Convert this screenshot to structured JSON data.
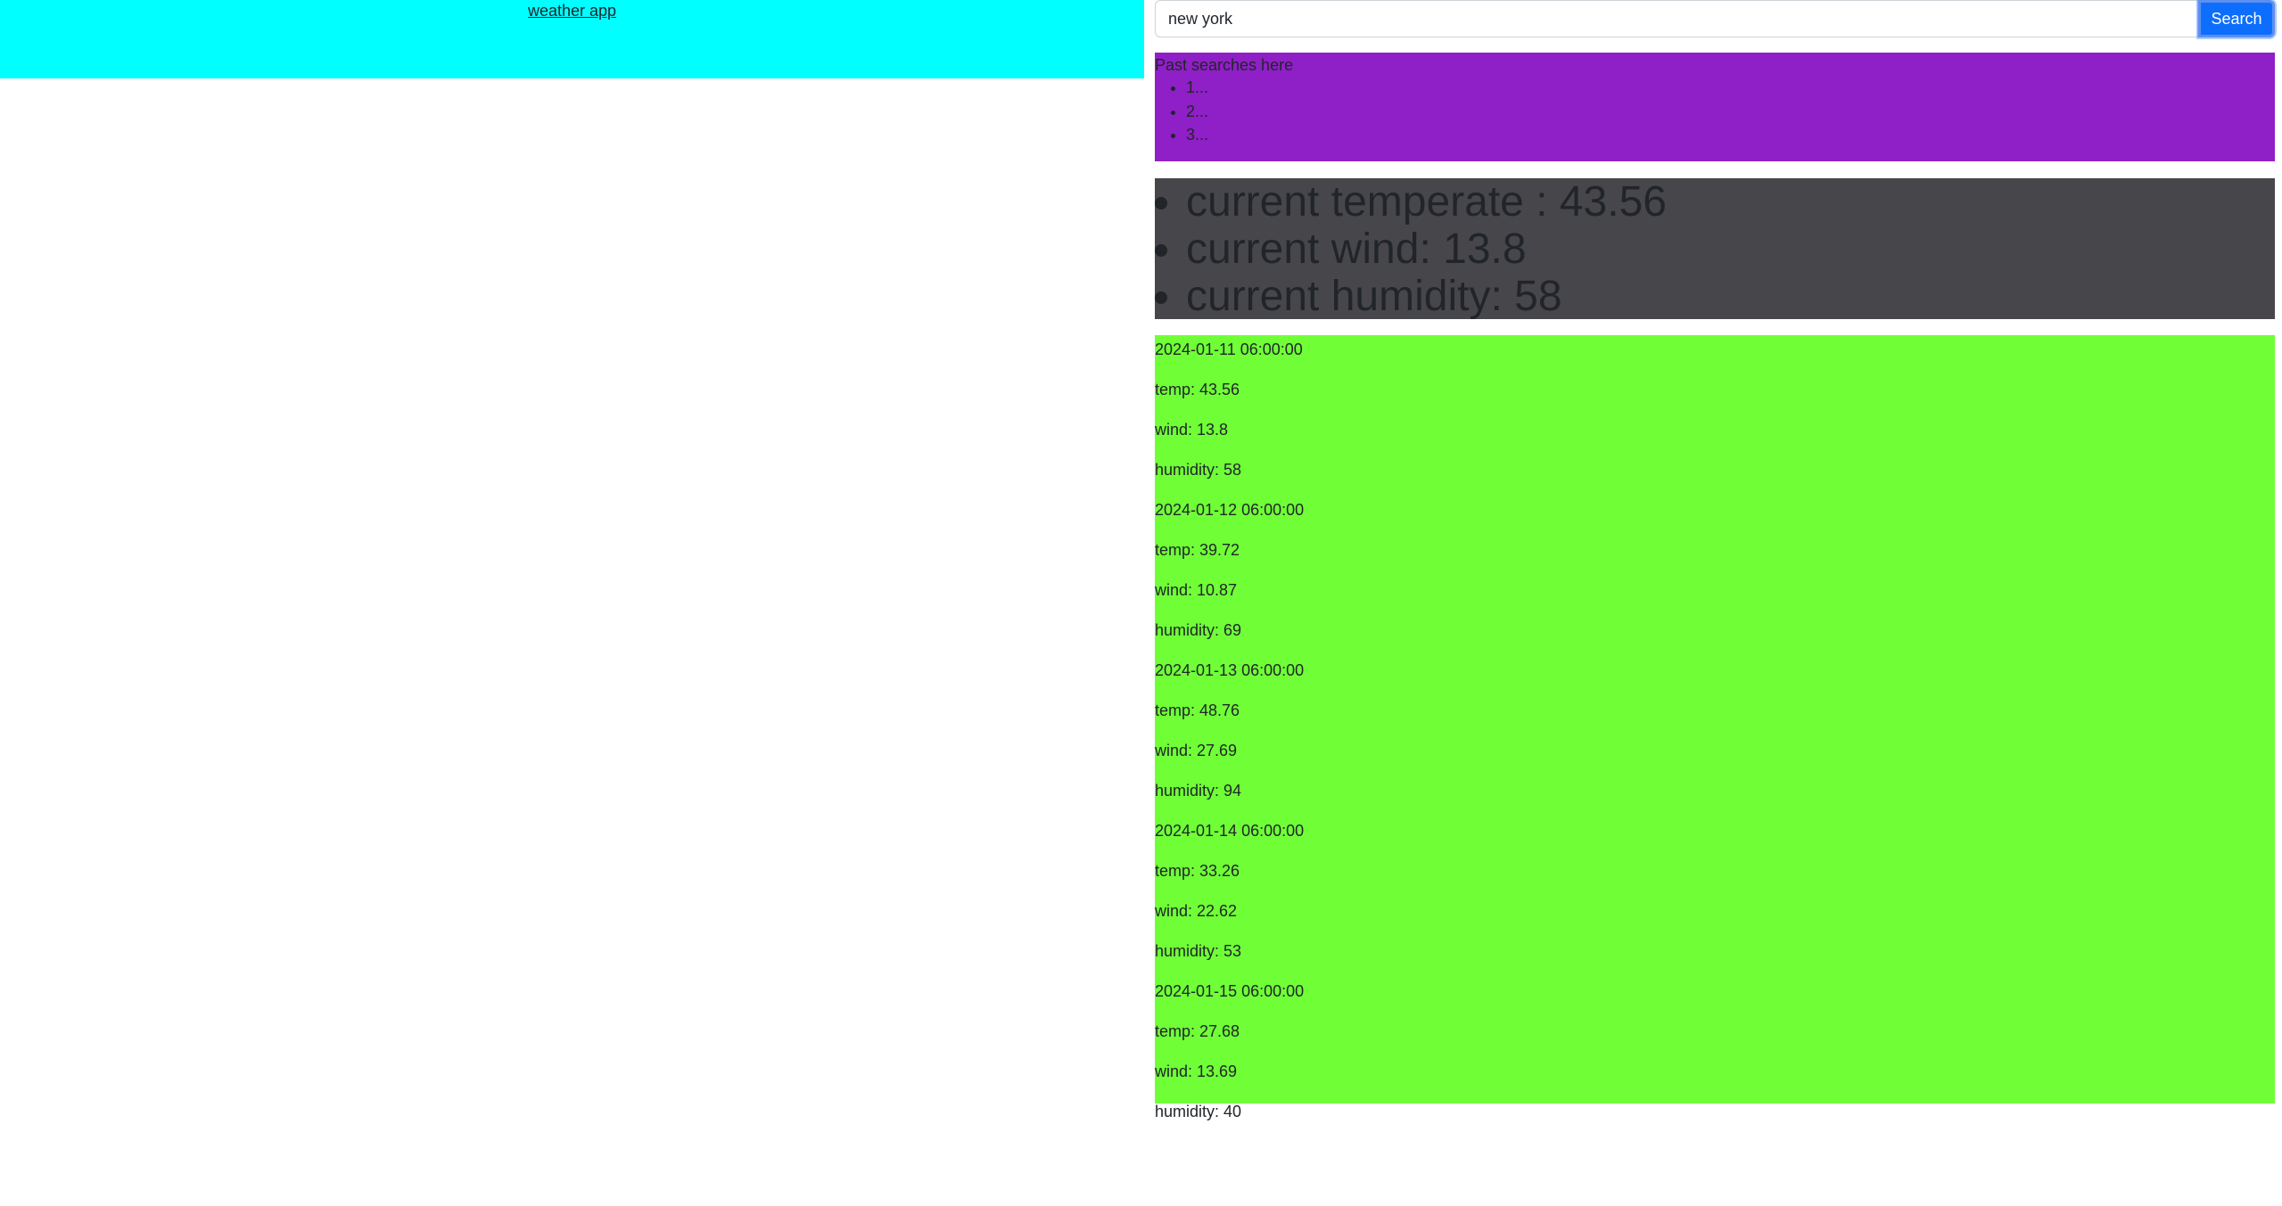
{
  "header": {
    "app_link": "weather app"
  },
  "search": {
    "value": "new york",
    "button_label": "Search"
  },
  "past_searches": {
    "title": "Past searches here",
    "items": [
      "1...",
      "2...",
      "3..."
    ]
  },
  "current": {
    "temperature": "current temperate : 43.56",
    "wind": "current wind: 13.8",
    "humidity": "current humidity: 58"
  },
  "forecast": [
    {
      "date": "2024-01-11 06:00:00",
      "temp": "temp: 43.56",
      "wind": "wind: 13.8",
      "humidity": "humidity: 58"
    },
    {
      "date": "2024-01-12 06:00:00",
      "temp": "temp: 39.72",
      "wind": "wind: 10.87",
      "humidity": "humidity: 69"
    },
    {
      "date": "2024-01-13 06:00:00",
      "temp": "temp: 48.76",
      "wind": "wind: 27.69",
      "humidity": "humidity: 94"
    },
    {
      "date": "2024-01-14 06:00:00",
      "temp": "temp: 33.26",
      "wind": "wind: 22.62",
      "humidity": "humidity: 53"
    },
    {
      "date": "2024-01-15 06:00:00",
      "temp": "temp: 27.68",
      "wind": "wind: 13.69",
      "humidity": "humidity: 40"
    }
  ],
  "colors": {
    "header_bg": "#00ffff",
    "past_bg": "#8f1fc6",
    "current_bg": "#47474b",
    "forecast_bg": "#70ff37",
    "button_bg": "#0d6efd"
  }
}
